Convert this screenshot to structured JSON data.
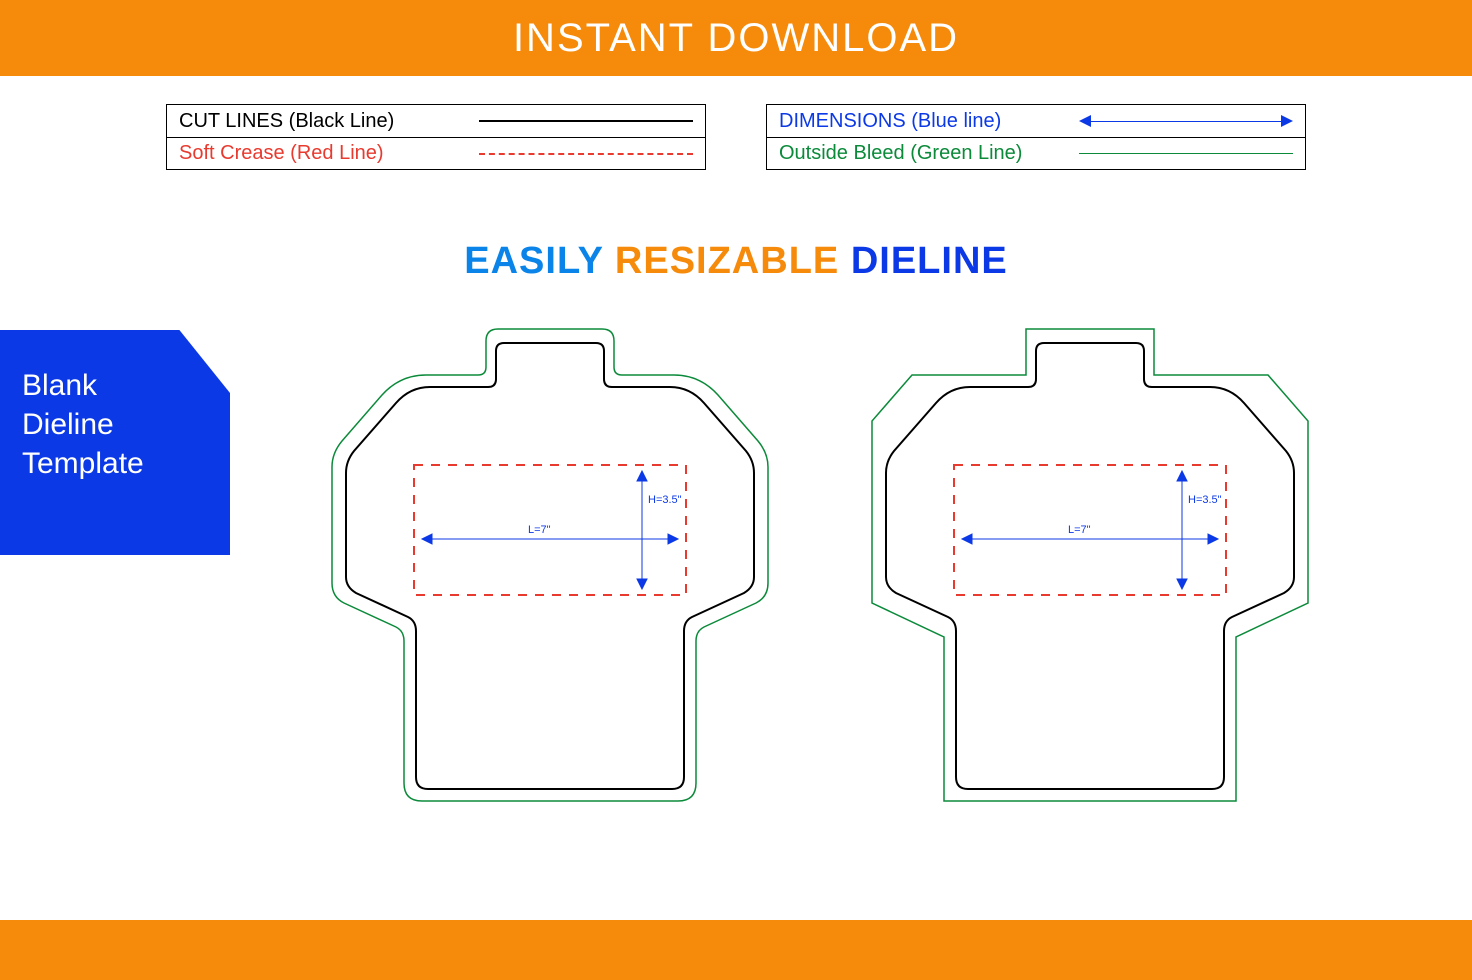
{
  "banner": {
    "top_text": "INSTANT DOWNLOAD"
  },
  "legend": {
    "left": {
      "row1_label": "CUT LINES (Black Line)",
      "row2_label": "Soft Crease (Red Line)"
    },
    "right": {
      "row1_label": "DIMENSIONS (Blue line)",
      "row2_label": "Outside Bleed (Green Line)"
    }
  },
  "subtitle": {
    "word1": "EASILY",
    "word2": "RESIZABLE",
    "word3": "DIELINE"
  },
  "side_badge": {
    "line1": "Blank",
    "line2": "Dieline",
    "line3": "Template"
  },
  "dimensions": {
    "length_label": "L=7\"",
    "height_label": "H=3.5\""
  },
  "colors": {
    "accent_orange": "#f58a0b",
    "cut_black": "#000000",
    "crease_red": "#e83a2f",
    "dim_blue": "#0c39e6",
    "bleed_green": "#0b8a3a",
    "title_blue": "#0a84e8"
  }
}
